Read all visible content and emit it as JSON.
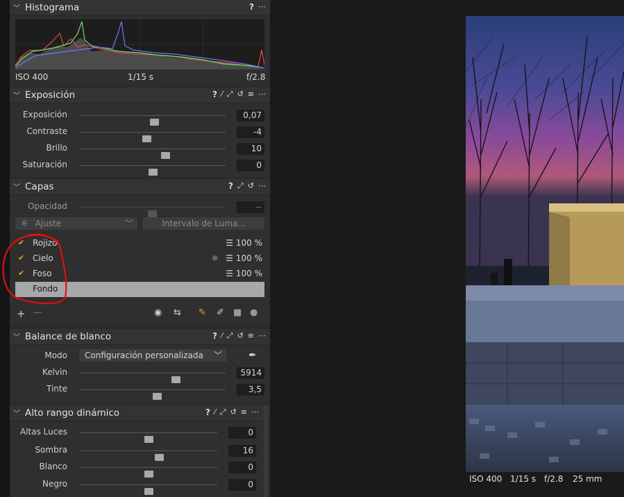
{
  "histogram": {
    "title": "Histograma",
    "iso": "ISO 400",
    "shutter": "1/15 s",
    "aperture": "f/2.8"
  },
  "exposure": {
    "title": "Exposición",
    "sliders": [
      {
        "label": "Exposición",
        "value": "0,07",
        "level": 0.51
      },
      {
        "label": "Contraste",
        "value": "-4",
        "level": 0.46
      },
      {
        "label": "Brillo",
        "value": "10",
        "level": 0.59
      },
      {
        "label": "Saturación",
        "value": "0",
        "level": 0.5
      }
    ]
  },
  "layers": {
    "title": "Capas",
    "opacity_label": "Opacidad",
    "opacity_value": "--",
    "adjust_label": "Ajuste",
    "luma_label": "Intervalo de Luma...",
    "items": [
      {
        "name": "Rojizo",
        "pct": "100 %",
        "checked": true
      },
      {
        "name": "Cielo",
        "pct": "100 %",
        "checked": true
      },
      {
        "name": "Foso",
        "pct": "100 %",
        "checked": true
      },
      {
        "name": "Fondo",
        "pct": "",
        "checked": false
      }
    ]
  },
  "white_balance": {
    "title": "Balance de blanco",
    "mode_label": "Modo",
    "mode_value": "Configuración personalizada",
    "sliders": [
      {
        "label": "Kelvin",
        "value": "5914",
        "level": 0.66
      },
      {
        "label": "Tinte",
        "value": "3,5",
        "level": 0.53
      }
    ]
  },
  "hdr": {
    "title": "Alto rango dinámico",
    "sliders": [
      {
        "label": "Altas Luces",
        "value": "0",
        "level": 0.5
      },
      {
        "label": "Sombra",
        "value": "16",
        "level": 0.58
      },
      {
        "label": "Blanco",
        "value": "0",
        "level": 0.5
      },
      {
        "label": "Negro",
        "value": "0",
        "level": 0.5
      }
    ]
  },
  "viewer": {
    "iso": "ISO 400",
    "shutter": "1/15 s",
    "aperture": "f/2.8",
    "focal": "25 mm"
  },
  "icons": {
    "help": "?",
    "more": "⋯"
  }
}
